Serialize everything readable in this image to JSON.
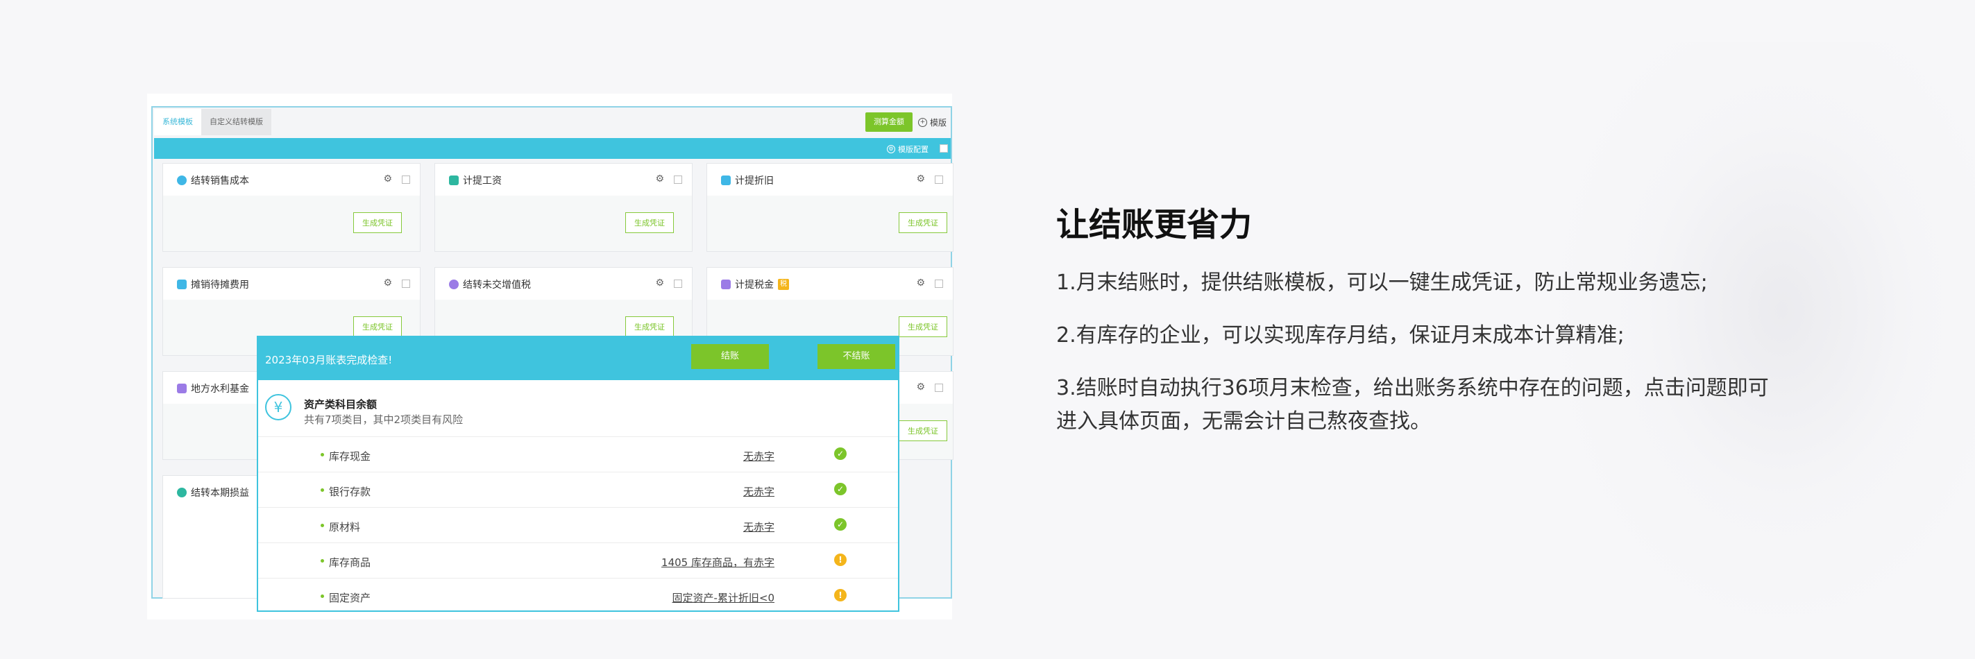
{
  "template_panel": {
    "tabs": [
      {
        "label": "系统模板"
      },
      {
        "label": "自定义结转模版"
      }
    ],
    "actions": {
      "primary_label": "测算金额",
      "template_label": "模版"
    },
    "config_label": "模版配置",
    "generate_label": "生成凭证",
    "cards": [
      {
        "title": "结转销售成本",
        "icon": "money-bag-icon",
        "color": "#3fb7e6"
      },
      {
        "title": "计提工资",
        "icon": "doc-icon",
        "color": "#2db7a0"
      },
      {
        "title": "计提折旧",
        "icon": "doc-icon",
        "color": "#3fb7e6"
      },
      {
        "title": "摊销待摊费用",
        "icon": "grid-icon",
        "color": "#3fb7e6"
      },
      {
        "title": "结转未交增值税",
        "icon": "money-bag-icon",
        "color": "#9b7be6"
      },
      {
        "title": "计提税金",
        "icon": "stack-icon",
        "color": "#9b7be6",
        "badge": "税"
      },
      {
        "title": "地方水利基金",
        "icon": "grid-icon",
        "color": "#9b7be6"
      },
      {
        "title": "结转本期损益",
        "icon": "money-bag-icon",
        "color": "#2db7a0"
      }
    ]
  },
  "modal": {
    "title": "2023年03月账表完成检查!",
    "buttons": {
      "close": "结账",
      "cancel": "不结账"
    },
    "section": {
      "icon": "yen-icon",
      "title": "资产类科目余额",
      "subtitle": "共有7项类目，其中2项类目有风险"
    },
    "rows": [
      {
        "name": "库存现金",
        "value": "无赤字",
        "status": "ok"
      },
      {
        "name": "银行存款",
        "value": "无赤字",
        "status": "ok"
      },
      {
        "name": "原材料",
        "value": "无赤字",
        "status": "ok"
      },
      {
        "name": "库存商品",
        "value": "1405 库存商品，有赤字",
        "status": "warning"
      },
      {
        "name": "固定资产",
        "value": "固定资产-累计折旧<0",
        "status": "warning"
      }
    ],
    "colors": {
      "accent": "#3fc4de",
      "button": "#7cc52a",
      "ok": "#7cc52a",
      "warning": "#f4b51b"
    }
  },
  "feature": {
    "heading": "让结账更省力",
    "points": [
      "1.月末结账时，提供结账模板，可以一键生成凭证，防止常规业务遗忘;",
      "2.有库存的企业，可以实现库存月结，保证月末成本计算精准;",
      "3.结账时自动执行36项月末检查，给出账务系统中存在的问题，点击问题即可",
      "进入具体页面，无需会计自己熬夜查找。"
    ]
  }
}
